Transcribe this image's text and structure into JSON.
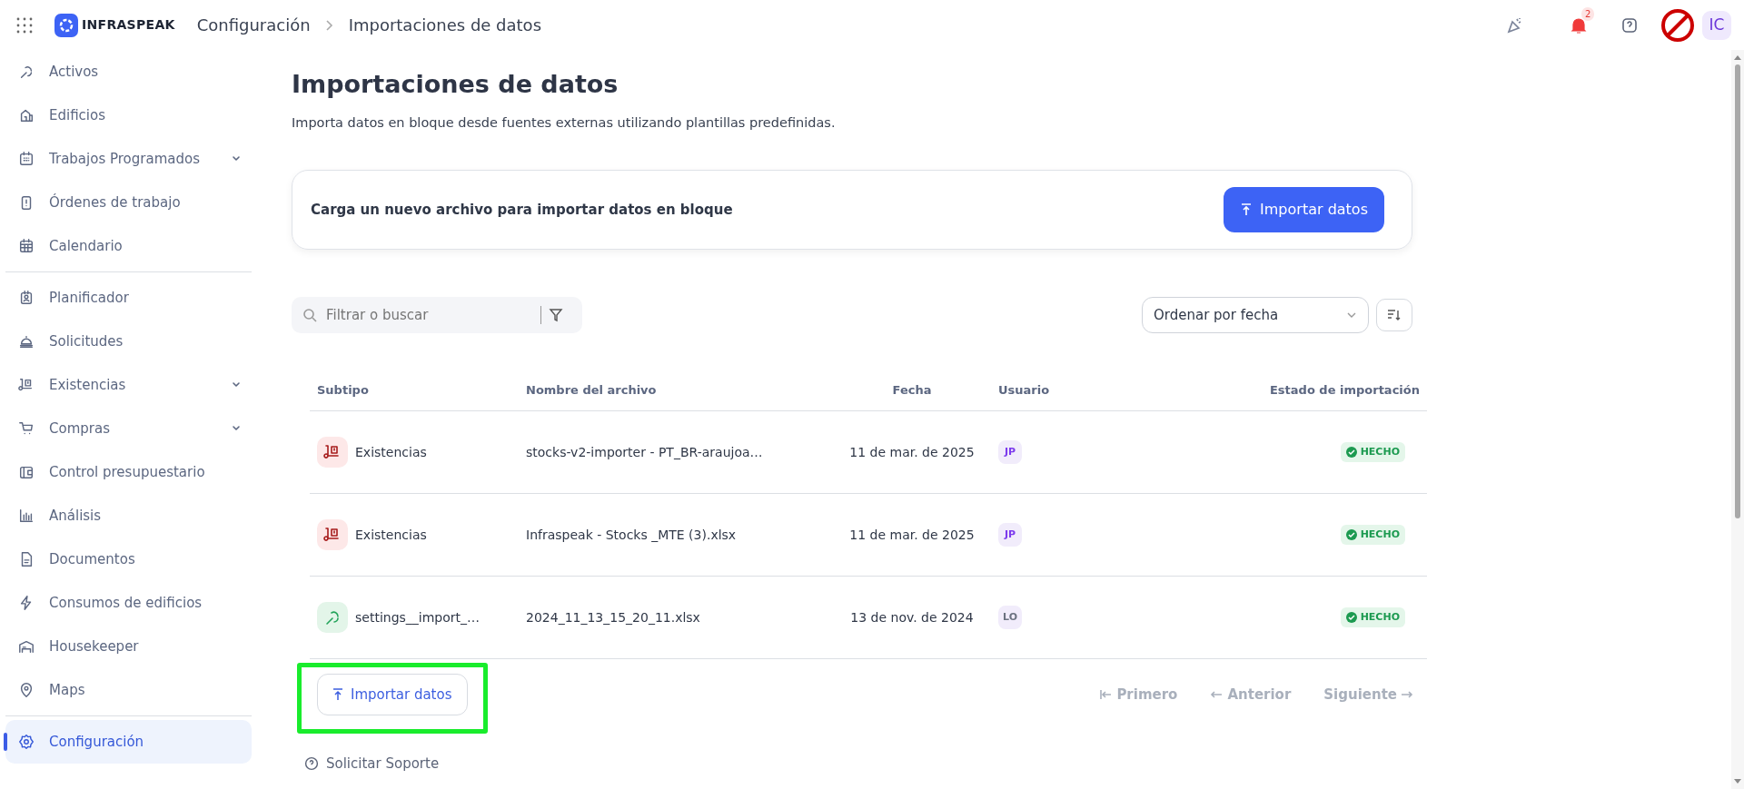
{
  "top_bar": {
    "brand": "INFRASPEAK",
    "breadcrumb": [
      "Configuración",
      "Importaciones de datos"
    ],
    "notification_count": "2",
    "avatar": "IC"
  },
  "sidebar": {
    "groups": [
      [
        {
          "label": "Activos",
          "expandable": false,
          "selected": false
        },
        {
          "label": "Edificios",
          "expandable": false,
          "selected": false
        },
        {
          "label": "Trabajos Programados",
          "expandable": true,
          "selected": false
        },
        {
          "label": "Órdenes de trabajo",
          "expandable": false,
          "selected": false
        },
        {
          "label": "Calendario",
          "expandable": false,
          "selected": false
        }
      ],
      [
        {
          "label": "Planificador",
          "expandable": false,
          "selected": false
        },
        {
          "label": "Solicitudes",
          "expandable": false,
          "selected": false
        },
        {
          "label": "Existencias",
          "expandable": true,
          "selected": false
        },
        {
          "label": "Compras",
          "expandable": true,
          "selected": false
        },
        {
          "label": "Control presupuestario",
          "expandable": false,
          "selected": false
        },
        {
          "label": "Análisis",
          "expandable": false,
          "selected": false
        },
        {
          "label": "Documentos",
          "expandable": false,
          "selected": false
        },
        {
          "label": "Consumos de edificios",
          "expandable": false,
          "selected": false
        },
        {
          "label": "Housekeeper",
          "expandable": false,
          "selected": false
        },
        {
          "label": "Maps",
          "expandable": false,
          "selected": false
        }
      ],
      [
        {
          "label": "Configuración",
          "expandable": false,
          "selected": true
        }
      ]
    ]
  },
  "page": {
    "title": "Importaciones de datos",
    "subtitle": "Importa datos en bloque desde fuentes externas utilizando plantillas predefinidas.",
    "upload_card": {
      "text": "Carga un nuevo archivo para importar datos en bloque",
      "button": "Importar datos"
    },
    "search": {
      "placeholder": "Filtrar o buscar"
    },
    "sort": {
      "value": "Ordenar por fecha"
    },
    "table": {
      "columns": [
        "Subtipo",
        "Nombre del archivo",
        "Fecha",
        "Usuario",
        "Estado de importación"
      ],
      "rows": [
        {
          "kind": "stock",
          "subtype": "Existencias",
          "file": "stocks-v2-importer - PT_BR-araujoa…",
          "date": "11 de mar. de 2025",
          "user": {
            "initials": "JP",
            "color": "#7c3aed"
          },
          "status": "HECHO"
        },
        {
          "kind": "stock",
          "subtype": "Existencias",
          "file": "Infraspeak - Stocks _MTE (3).xlsx",
          "date": "11 de mar. de 2025",
          "user": {
            "initials": "JP",
            "color": "#7c3aed"
          },
          "status": "HECHO"
        },
        {
          "kind": "settings",
          "subtype": "settings__import_…",
          "file": "2024_11_13_15_20_11.xlsx",
          "date": "13 de nov. de 2024",
          "user": {
            "initials": "LO",
            "color": "#6b7280"
          },
          "status": "HECHO"
        }
      ]
    },
    "import_button": {
      "label": "Importar datos",
      "highlighted": true
    },
    "pagination": [
      {
        "label": "Primero",
        "kind": "first",
        "disabled": true
      },
      {
        "label": "Anterior",
        "kind": "prev",
        "disabled": true
      },
      {
        "label": "Siguiente",
        "kind": "next",
        "disabled": true
      }
    ],
    "support_link": "Solicitar Soporte"
  }
}
